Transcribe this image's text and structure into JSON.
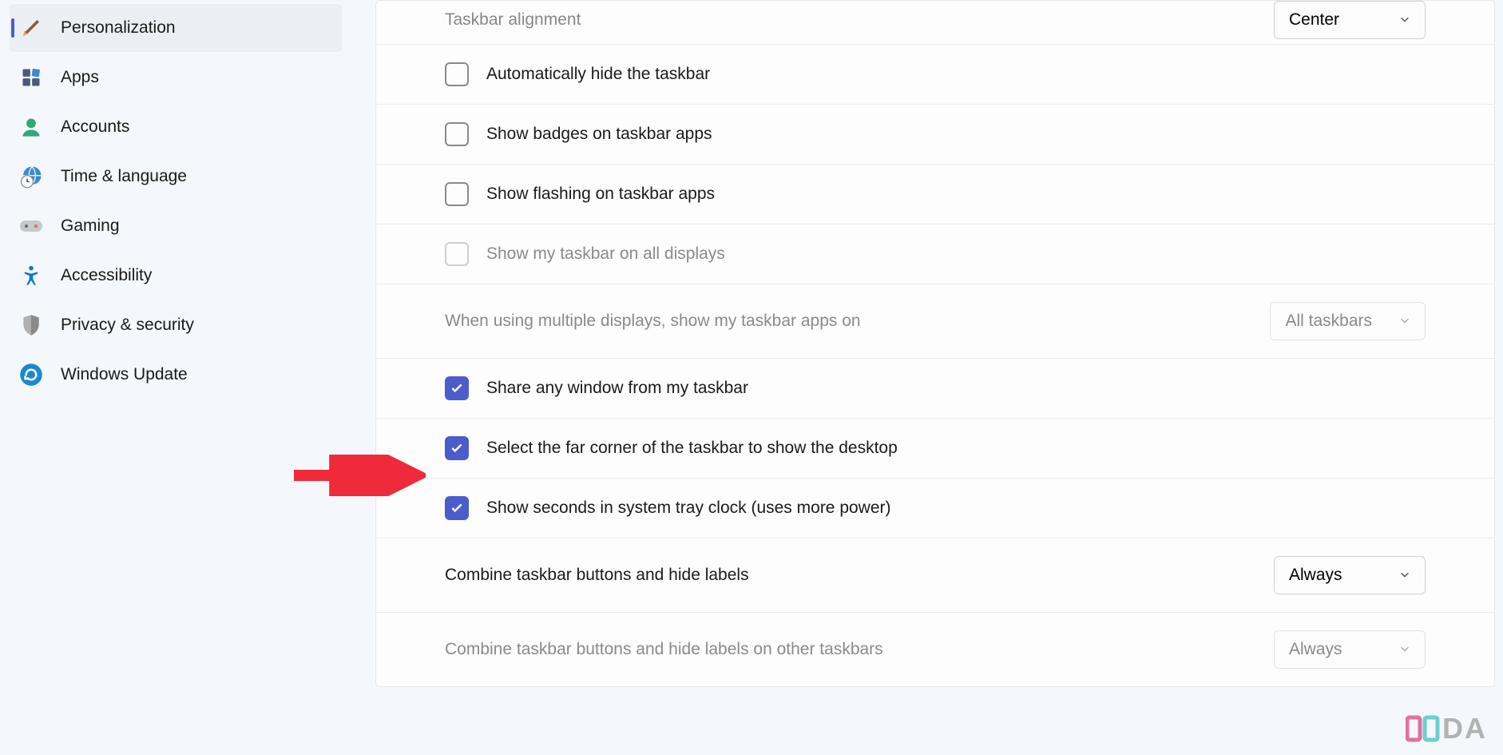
{
  "sidebar": {
    "items": [
      {
        "label": "Personalization",
        "icon": "paintbrush"
      },
      {
        "label": "Apps",
        "icon": "apps"
      },
      {
        "label": "Accounts",
        "icon": "person"
      },
      {
        "label": "Time & language",
        "icon": "globe-clock"
      },
      {
        "label": "Gaming",
        "icon": "gamepad"
      },
      {
        "label": "Accessibility",
        "icon": "accessibility"
      },
      {
        "label": "Privacy & security",
        "icon": "shield"
      },
      {
        "label": "Windows Update",
        "icon": "update"
      }
    ],
    "active_index": 0
  },
  "settings": {
    "taskbar_alignment": {
      "label": "Taskbar alignment",
      "value": "Center"
    },
    "auto_hide": {
      "label": "Automatically hide the taskbar",
      "checked": false
    },
    "show_badges": {
      "label": "Show badges on taskbar apps",
      "checked": false
    },
    "show_flashing": {
      "label": "Show flashing on taskbar apps",
      "checked": false
    },
    "show_on_all_displays": {
      "label": "Show my taskbar on all displays",
      "checked": false,
      "disabled": true
    },
    "multi_display_apps": {
      "label": "When using multiple displays, show my taskbar apps on",
      "value": "All taskbars",
      "disabled": true
    },
    "share_any_window": {
      "label": "Share any window from my taskbar",
      "checked": true
    },
    "far_corner_desktop": {
      "label": "Select the far corner of the taskbar to show the desktop",
      "checked": true
    },
    "show_seconds": {
      "label": "Show seconds in system tray clock (uses more power)",
      "checked": true
    },
    "combine_buttons": {
      "label": "Combine taskbar buttons and hide labels",
      "value": "Always"
    },
    "combine_buttons_other": {
      "label": "Combine taskbar buttons and hide labels on other taskbars",
      "value": "Always",
      "disabled": true
    }
  },
  "watermark": {
    "text": "XDA"
  }
}
